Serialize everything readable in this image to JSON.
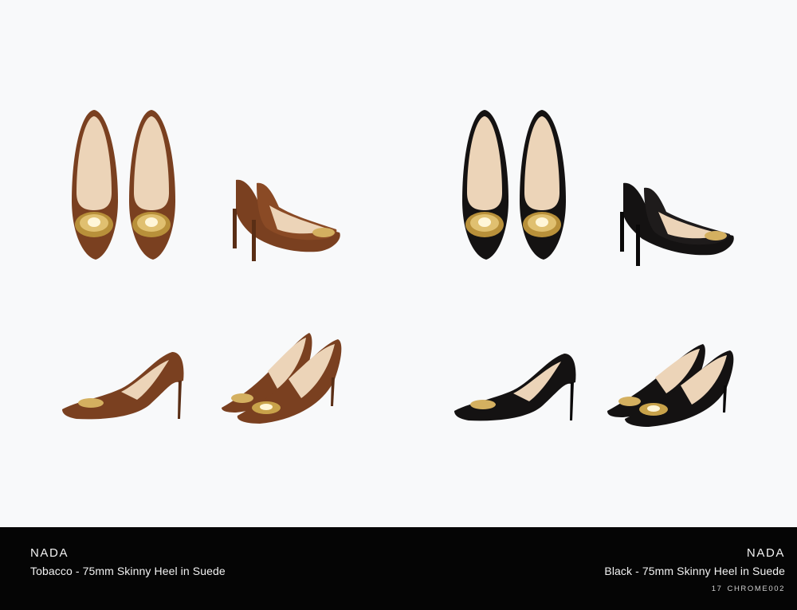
{
  "colors": {
    "tobacco": "#7a4020",
    "tobacco_dark": "#5a2e15",
    "black": "#141212",
    "lining": "#ecd4b8",
    "gold": "#c8a24a",
    "footer_bg": "#050505"
  },
  "products": [
    {
      "model": "NADA",
      "description": "Tobacco - 75mm Skinny Heel in Suede",
      "color_key": "tobacco"
    },
    {
      "model": "NADA",
      "description": "Black - 75mm Skinny Heel in Suede",
      "color_key": "black"
    }
  ],
  "page": {
    "number": "17",
    "code": "CHROME002"
  }
}
